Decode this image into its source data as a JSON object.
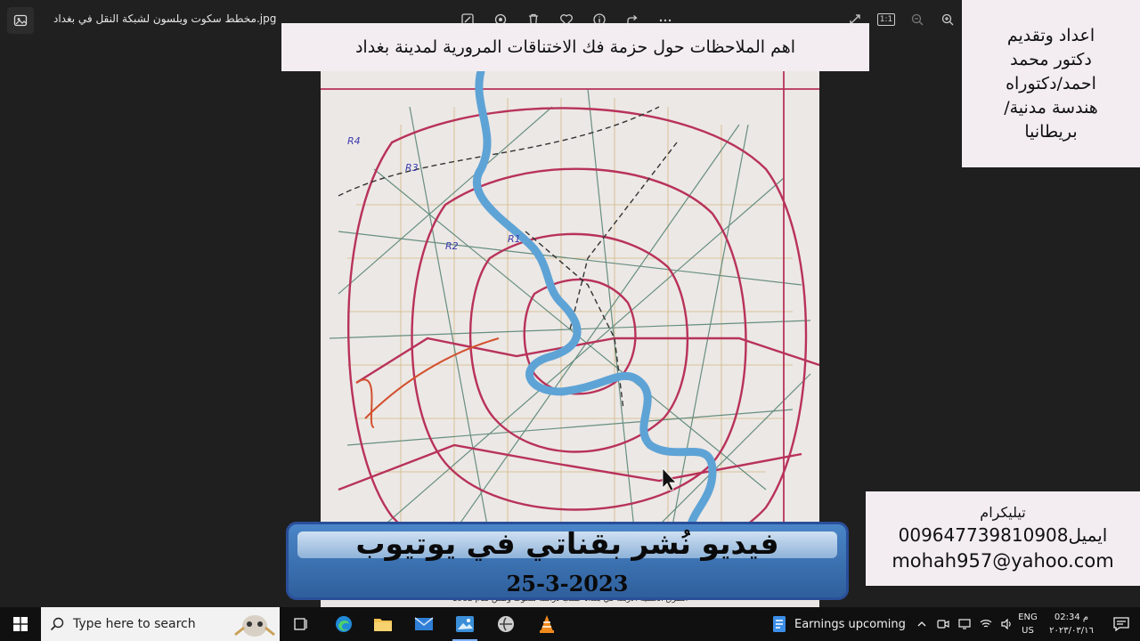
{
  "viewer": {
    "file_title": "مخطط سكوت ويلسون لشبكة النقل في بغداد.jpg",
    "toolbar_icons": [
      "edit-image-icon",
      "visual-search-icon",
      "delete-icon",
      "favorite-icon",
      "info-icon",
      "share-icon",
      "more-icon"
    ],
    "right_icons": [
      "expand-icon",
      "actual-size-icon",
      "zoom-out-icon",
      "zoom-in-icon"
    ],
    "actual_size_label": "1:1"
  },
  "overlays": {
    "header": "اهم الملاحظات حول حزمة فك الاختناقات المرورية لمدينة بغداد",
    "author_lines": [
      "اعداد وتقديم",
      "دكتور محمد",
      "احمد/دكتوراه",
      "هندسة مدنية/",
      "بريطانيا"
    ],
    "contact": {
      "telegram_label": "تيليكرام",
      "phone_line": "009647739810908ايميل",
      "email": "mohah957@yahoo.com"
    },
    "youtube_banner": {
      "title": "فيديو نُشر بقناتي في يوتيوب",
      "date": "25-3-2023"
    },
    "map_caption": "الطرق الحلقية الاربعة في بغداد حسب دراسة سكوت ولسن لعام 1982"
  },
  "map": {
    "ring_labels": [
      "R4",
      "R3",
      "R2",
      "R1"
    ],
    "colors": {
      "paper": "#ece8e5",
      "ring": "#b8325a",
      "river": "#5ea3d6",
      "grid": "#4f7f6f",
      "local": "#c9a25a"
    }
  },
  "taskbar": {
    "search_placeholder": "Type here to search",
    "news_text": "Earnings upcoming",
    "lang_line1": "ENG",
    "lang_line2": "US",
    "time": "02:34 م",
    "date": "٢٠٢٣/٠٣/١٦",
    "apps": [
      "task-view-icon",
      "edge-icon",
      "file-explorer-icon",
      "mail-icon",
      "photos-icon",
      "media-app-icon",
      "vlc-icon"
    ]
  }
}
